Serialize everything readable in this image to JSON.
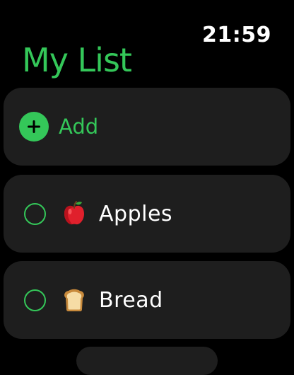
{
  "status": {
    "time": "21:59"
  },
  "header": {
    "title": "My List"
  },
  "add_button": {
    "label": "Add",
    "icon": "plus-circle-icon"
  },
  "items": [
    {
      "label": "Apples",
      "emoji": "apple-emoji-icon",
      "checked": false
    },
    {
      "label": "Bread",
      "emoji": "bread-emoji-icon",
      "checked": false
    }
  ],
  "colors": {
    "accent": "#34c759",
    "card_bg": "#1e1e1e",
    "background": "#000000",
    "text": "#ffffff"
  }
}
